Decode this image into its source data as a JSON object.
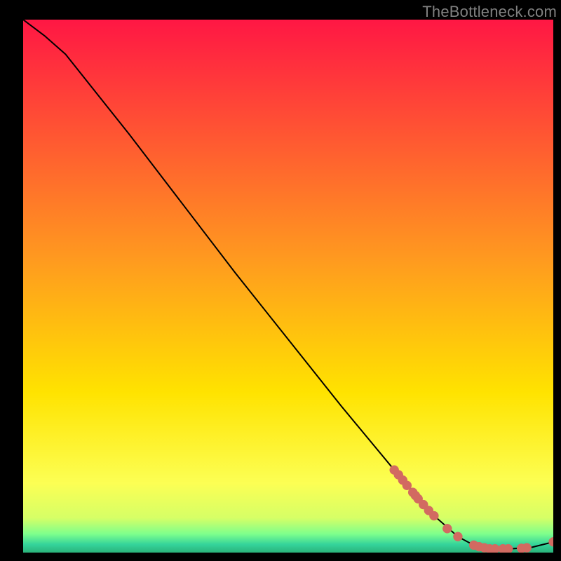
{
  "watermark": "TheBottleneck.com",
  "chart_data": {
    "type": "line",
    "title": "",
    "xlabel": "",
    "ylabel": "",
    "xlim": [
      0,
      100
    ],
    "ylim": [
      0,
      100
    ],
    "curve": [
      {
        "x": 0,
        "y": 100
      },
      {
        "x": 4,
        "y": 97
      },
      {
        "x": 8,
        "y": 93.5
      },
      {
        "x": 10,
        "y": 91
      },
      {
        "x": 20,
        "y": 78.5
      },
      {
        "x": 30,
        "y": 65.5
      },
      {
        "x": 40,
        "y": 52.5
      },
      {
        "x": 50,
        "y": 40
      },
      {
        "x": 60,
        "y": 27.5
      },
      {
        "x": 70,
        "y": 15.5
      },
      {
        "x": 78,
        "y": 6.5
      },
      {
        "x": 82,
        "y": 3.0
      },
      {
        "x": 85,
        "y": 1.4
      },
      {
        "x": 88,
        "y": 0.7
      },
      {
        "x": 92,
        "y": 0.7
      },
      {
        "x": 96,
        "y": 1.0
      },
      {
        "x": 100,
        "y": 2.0
      }
    ],
    "markers": [
      {
        "x": 70.0,
        "y": 15.5
      },
      {
        "x": 70.8,
        "y": 14.6
      },
      {
        "x": 71.6,
        "y": 13.6
      },
      {
        "x": 72.4,
        "y": 12.6
      },
      {
        "x": 73.5,
        "y": 11.3
      },
      {
        "x": 74.0,
        "y": 10.7
      },
      {
        "x": 74.5,
        "y": 10.1
      },
      {
        "x": 75.5,
        "y": 9.0
      },
      {
        "x": 76.5,
        "y": 7.9
      },
      {
        "x": 77.5,
        "y": 6.9
      },
      {
        "x": 80.0,
        "y": 4.5
      },
      {
        "x": 82.0,
        "y": 3.0
      },
      {
        "x": 85.0,
        "y": 1.4
      },
      {
        "x": 86.0,
        "y": 1.1
      },
      {
        "x": 87.0,
        "y": 0.9
      },
      {
        "x": 88.0,
        "y": 0.7
      },
      {
        "x": 89.0,
        "y": 0.7
      },
      {
        "x": 90.5,
        "y": 0.7
      },
      {
        "x": 91.5,
        "y": 0.7
      },
      {
        "x": 94.0,
        "y": 0.8
      },
      {
        "x": 95.0,
        "y": 0.9
      },
      {
        "x": 100.0,
        "y": 2.0
      }
    ],
    "gradient": {
      "stops": [
        {
          "offset": 0.0,
          "color": "#ff1744"
        },
        {
          "offset": 0.45,
          "color": "#ff9a1f"
        },
        {
          "offset": 0.7,
          "color": "#ffe300"
        },
        {
          "offset": 0.87,
          "color": "#fcff54"
        },
        {
          "offset": 0.935,
          "color": "#d6ff66"
        },
        {
          "offset": 0.965,
          "color": "#7eff8c"
        },
        {
          "offset": 0.985,
          "color": "#34d39a"
        },
        {
          "offset": 1.0,
          "color": "#2bb37a"
        }
      ]
    }
  }
}
